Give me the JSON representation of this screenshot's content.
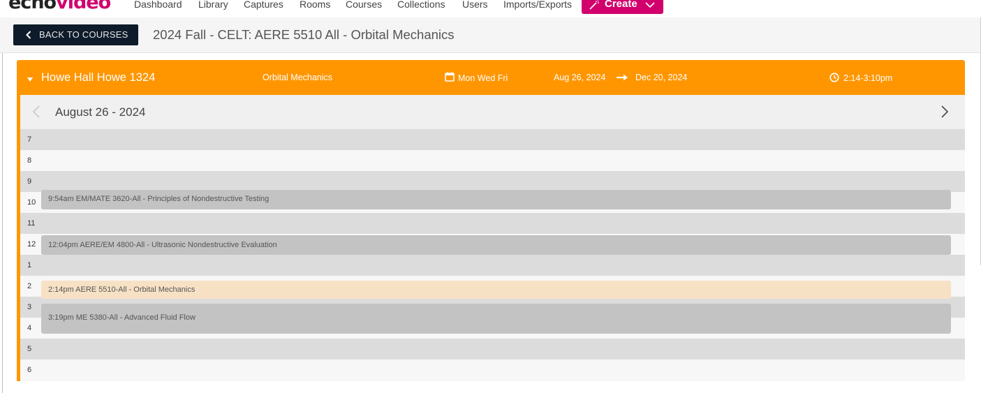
{
  "app": {
    "logo_part1": "echo",
    "logo_part2": "video"
  },
  "nav": {
    "items": [
      {
        "label": "Dashboard"
      },
      {
        "label": "Library"
      },
      {
        "label": "Captures"
      },
      {
        "label": "Rooms"
      },
      {
        "label": "Courses"
      },
      {
        "label": "Collections"
      },
      {
        "label": "Users"
      },
      {
        "label": "Imports/Exports"
      }
    ],
    "create_label": "Create"
  },
  "header": {
    "back_label": "BACK TO COURSES",
    "title": "2024 Fall - CELT: AERE 5510 All - Orbital Mechanics"
  },
  "section": {
    "room": "Howe Hall Howe 1324",
    "course": "Orbital Mechanics",
    "days": "Mon Wed Fri",
    "start_date": "Aug 26, 2024",
    "end_date": "Dec 20, 2024",
    "time_range": "2:14-3:10pm"
  },
  "calendar": {
    "week_label": "August 26 - 2024",
    "hours": [
      "7",
      "8",
      "9",
      "10",
      "11",
      "12",
      "1",
      "2",
      "3",
      "4",
      "5",
      "6"
    ],
    "events": [
      {
        "label": "9:54am EM/MATE 3620-All - Principles of Nondestructive Testing",
        "active": false
      },
      {
        "label": "12:04pm AERE/EM 4800-All - Ultrasonic Nondestructive Evaluation",
        "active": false
      },
      {
        "label": "2:14pm AERE 5510-All - Orbital Mechanics",
        "active": true
      },
      {
        "label": "3:19pm ME 5380-All - Advanced Fluid Flow",
        "active": false
      }
    ]
  },
  "colors": {
    "brand": "#d2006d",
    "section": "#ff9600",
    "back_button": "#0d1b2a"
  }
}
